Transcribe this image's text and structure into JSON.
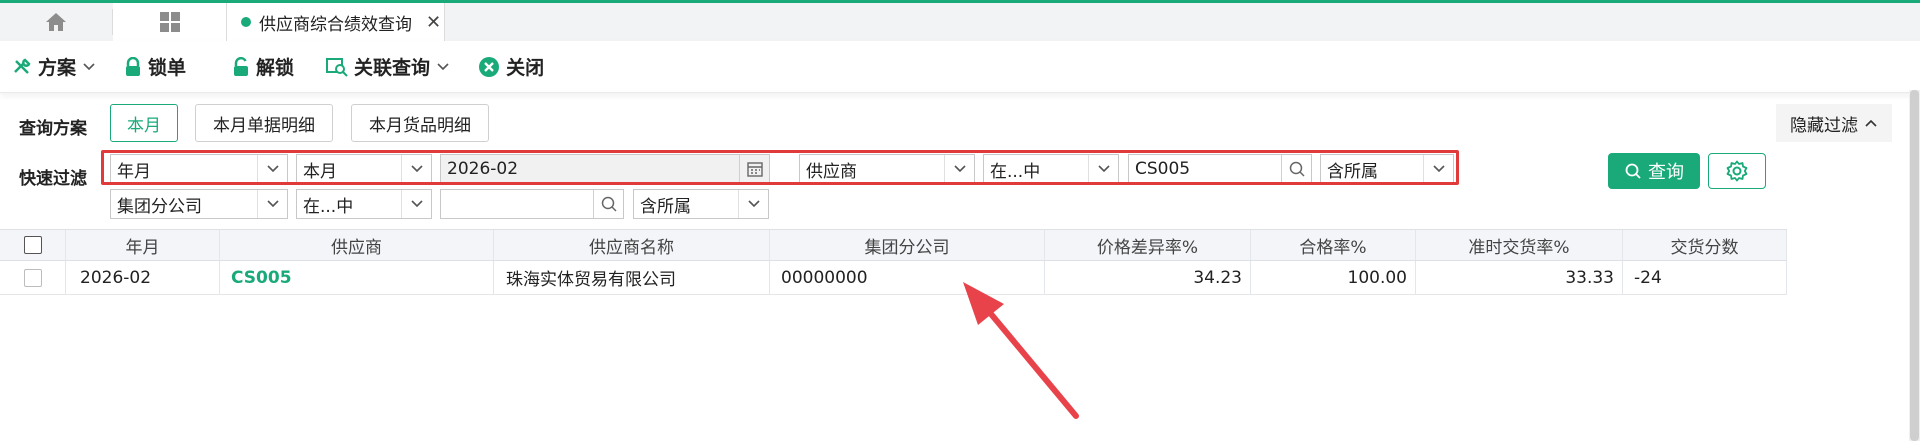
{
  "tabs": {
    "active_label": "供应商综合绩效查询",
    "close_symbol": "✕"
  },
  "toolbar": {
    "scheme_label": "方案",
    "lock_label": "锁单",
    "unlock_label": "解锁",
    "related_query_label": "关联查询",
    "close_label": "关闭"
  },
  "filter": {
    "scheme_title": "查询方案",
    "scheme_chips": [
      "本月",
      "本月单据明细",
      "本月货品明细"
    ],
    "quick_title": "快速过滤",
    "hide_filter_label": "隐藏过滤",
    "row1": {
      "field1": "年月",
      "op1": "本月",
      "value1": "2026-02",
      "field2": "供应商",
      "op2": "在...中",
      "value2": "CS005",
      "scope2": "含所属"
    },
    "row2": {
      "field": "集团分公司",
      "op": "在...中",
      "value": "",
      "scope": "含所属"
    },
    "query_label": "查询"
  },
  "grid": {
    "columns": [
      "年月",
      "供应商",
      "供应商名称",
      "集团分公司",
      "价格差异率%",
      "合格率%",
      "准时交货率%",
      "交货分数"
    ],
    "rows": [
      {
        "year_month": "2026-02",
        "supplier": "CS005",
        "supplier_name": "珠海实体贸易有限公司",
        "branch": "00000000",
        "price_diff": "34.23",
        "pass_rate": "100.00",
        "on_time": "33.33",
        "delivery_score": "-24"
      }
    ]
  },
  "colors": {
    "accent": "#1aaa7a",
    "highlight_border": "#e03a3a",
    "annotation_arrow": "#e8434a"
  }
}
